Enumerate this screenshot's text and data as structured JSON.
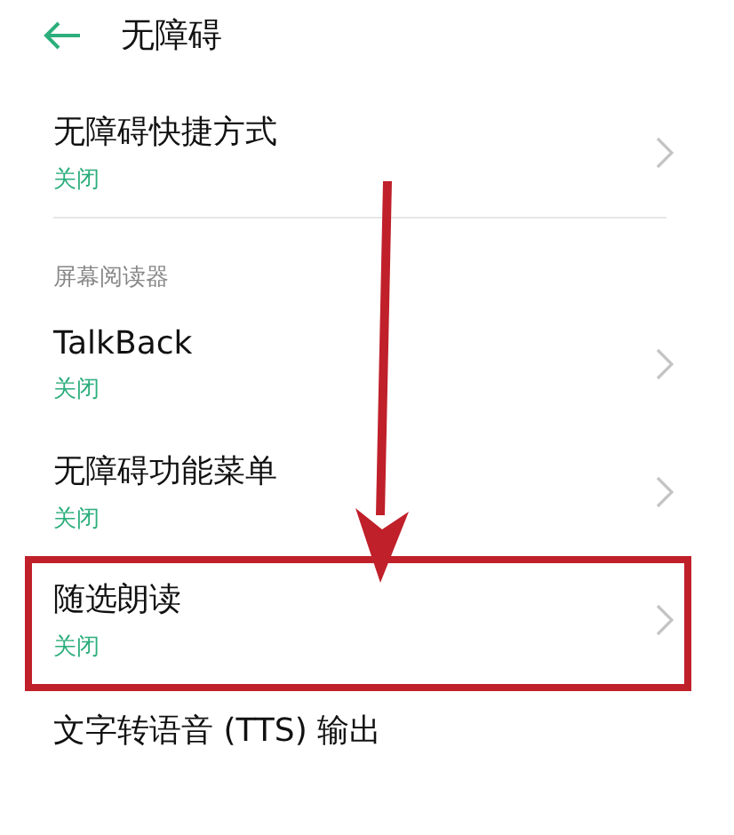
{
  "header": {
    "title": "无障碍"
  },
  "items": [
    {
      "kind": "setting",
      "title": "无障碍快捷方式",
      "status": "关闭",
      "highlighted": false
    },
    {
      "kind": "divider"
    },
    {
      "kind": "section",
      "title": "屏幕阅读器"
    },
    {
      "kind": "setting",
      "title": "TalkBack",
      "status": "关闭",
      "highlighted": false
    },
    {
      "kind": "setting",
      "title": "无障碍功能菜单",
      "status": "关闭",
      "highlighted": false
    },
    {
      "kind": "setting",
      "title": "随选朗读",
      "status": "关闭",
      "highlighted": true
    },
    {
      "kind": "plain",
      "title": "文字转语音 (TTS) 输出"
    }
  ]
}
